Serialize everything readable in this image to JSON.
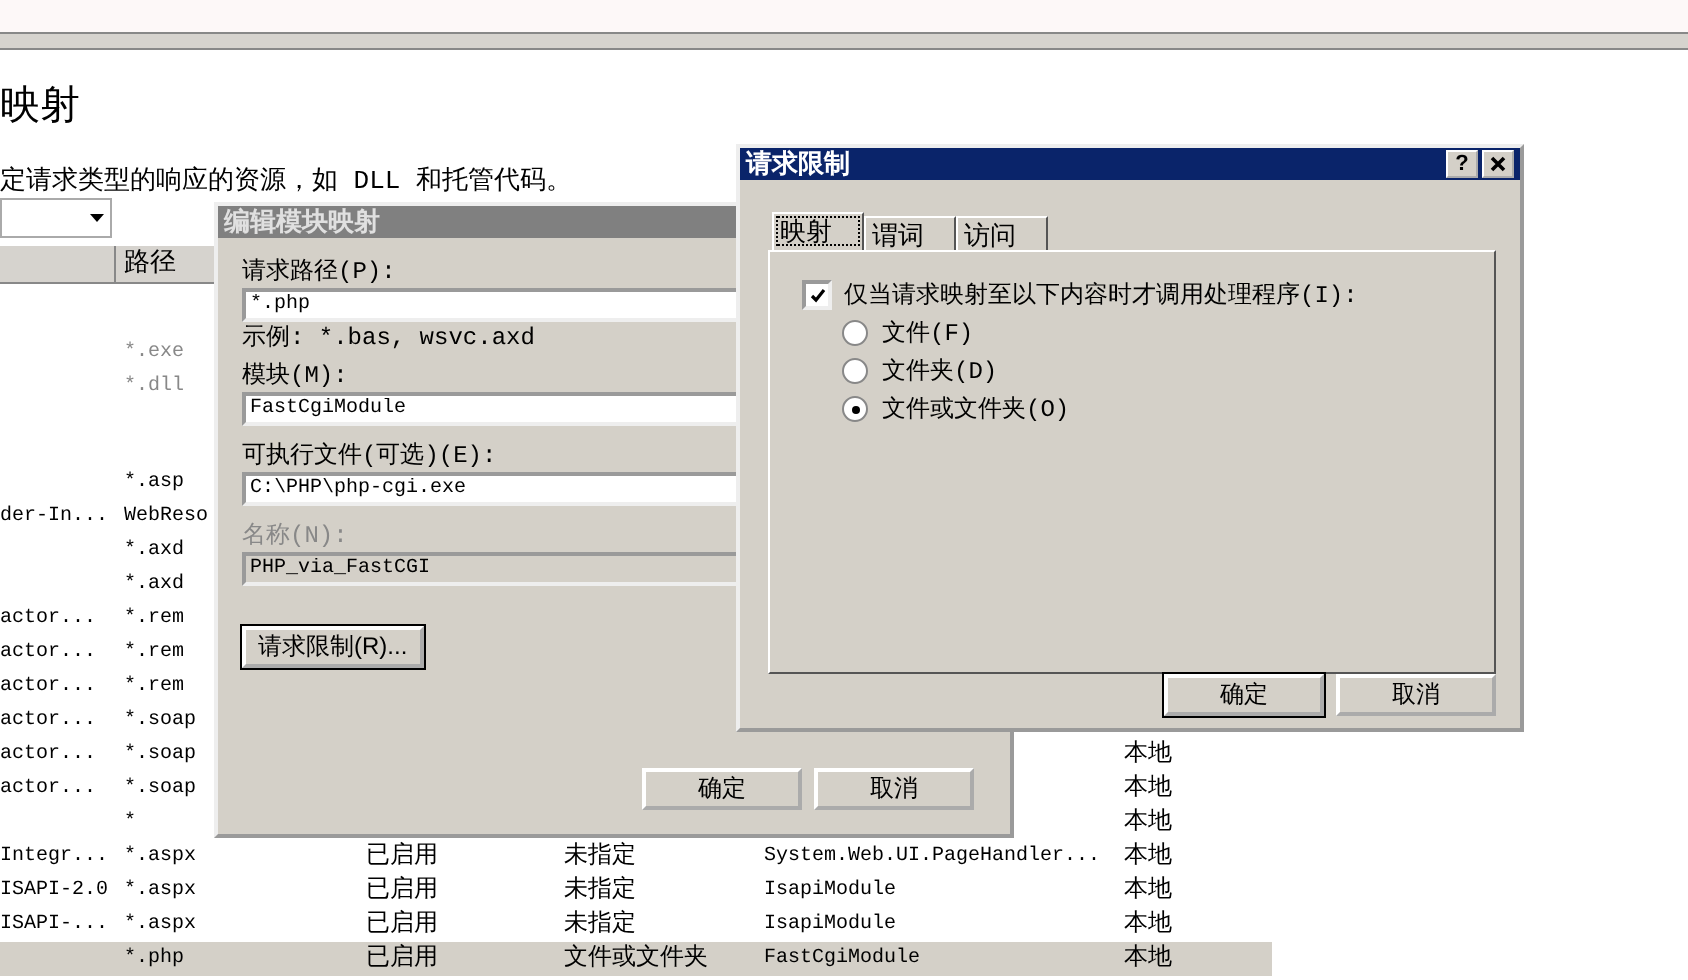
{
  "page": {
    "title": "映射",
    "description": "定请求类型的响应的资源，如 DLL 和托管代码。"
  },
  "table": {
    "path_header": "路径",
    "rows": [
      {
        "path": "*.exe",
        "disabled": true,
        "selected": false
      },
      {
        "path": "*.dll",
        "disabled": true,
        "selected": false
      },
      {
        "path": "*.asp",
        "disabled": false,
        "selected": false
      },
      {
        "name": "der-In...",
        "path": "WebReso",
        "disabled": false,
        "selected": false
      },
      {
        "path": "*.axd",
        "disabled": false,
        "selected": false
      },
      {
        "path": "*.axd",
        "disabled": false,
        "selected": false
      },
      {
        "name": "actor...",
        "path": "*.rem",
        "disabled": false,
        "selected": false
      },
      {
        "name": "actor...",
        "path": "*.rem",
        "disabled": false,
        "selected": false
      },
      {
        "name": "actor...",
        "path": "*.rem",
        "disabled": false,
        "selected": false
      },
      {
        "name": "actor...",
        "path": "*.soap",
        "disabled": false,
        "selected": false
      },
      {
        "name": "actor...",
        "path": "*.soap",
        "entry_type": "本地",
        "disabled": false,
        "selected": false
      },
      {
        "name": "actor...",
        "path": "*.soap",
        "entry_type": "本地",
        "disabled": false,
        "selected": false
      },
      {
        "path": "*",
        "entry_type": "本地",
        "disabled": false,
        "selected": false
      },
      {
        "name": "Integr...",
        "path": "*.aspx",
        "state": "已启用",
        "restriction": "未指定",
        "handler": "System.Web.UI.PageHandler...",
        "entry_type": "本地",
        "disabled": false,
        "selected": false
      },
      {
        "name": "ISAPI-2.0",
        "path": "*.aspx",
        "state": "已启用",
        "restriction": "未指定",
        "handler": "IsapiModule",
        "entry_type": "本地",
        "disabled": false,
        "selected": false
      },
      {
        "name": "ISAPI-...",
        "path": "*.aspx",
        "state": "已启用",
        "restriction": "未指定",
        "handler": "IsapiModule",
        "entry_type": "本地",
        "disabled": false,
        "selected": false
      },
      {
        "path": "*.php",
        "state": "已启用",
        "restriction": "文件或文件夹",
        "handler": "FastCgiModule",
        "entry_type": "本地",
        "disabled": false,
        "selected": true
      }
    ]
  },
  "edit_dialog": {
    "title": "编辑模块映射",
    "active": false,
    "fields": [
      {
        "label": "请求路径(P):",
        "value": "*.php",
        "hint": "示例: *.bas, wsvc.axd",
        "disabled": false
      },
      {
        "label": "模块(M):",
        "value": "FastCgiModule",
        "disabled": false
      },
      {
        "label": "可执行文件(可选)(E):",
        "value": "C:\\PHP\\php-cgi.exe",
        "disabled": false
      },
      {
        "label": "名称(N):",
        "value": "PHP_via_FastCGI",
        "disabled": true
      }
    ],
    "restriction_button": "请求限制(R)...",
    "buttons": [
      "确定",
      "取消"
    ]
  },
  "request_dialog": {
    "title": "请求限制",
    "active": true,
    "help_button": "?",
    "tabs": [
      {
        "label": "映射",
        "selected": true
      },
      {
        "label": "谓词",
        "selected": false
      },
      {
        "label": "访问",
        "selected": false
      }
    ],
    "checkbox": {
      "label": "仅当请求映射至以下内容时才调用处理程序(I):",
      "checked": true
    },
    "radios": [
      {
        "label": "文件(F)",
        "selected": false
      },
      {
        "label": "文件夹(D)",
        "selected": false
      },
      {
        "label": "文件或文件夹(O)",
        "selected": true
      }
    ],
    "buttons": [
      "确定",
      "取消"
    ]
  }
}
